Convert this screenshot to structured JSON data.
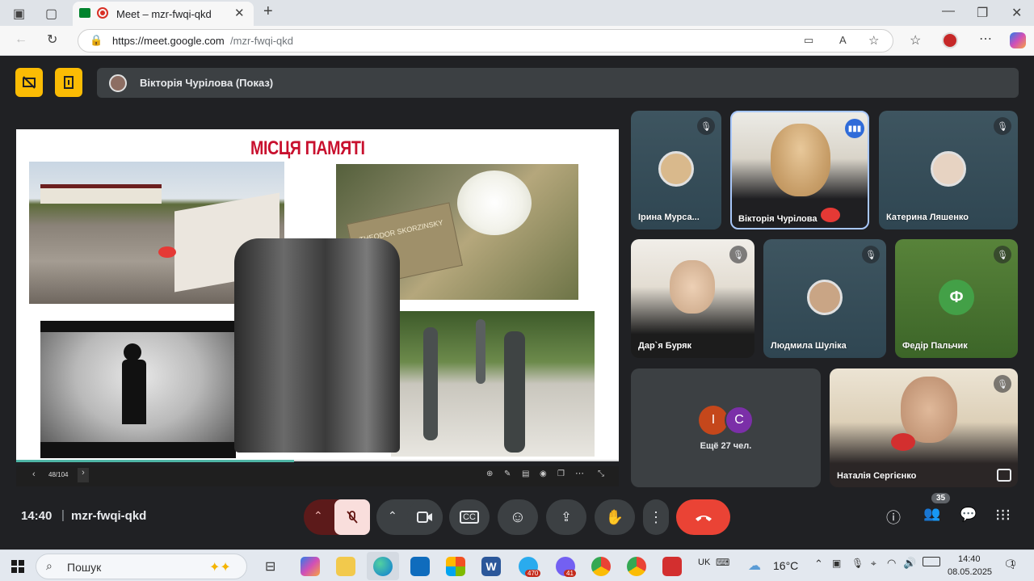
{
  "browser": {
    "tab_title": "Meet – mzr-fwqi-qkd",
    "url_host": "https://meet.google.com",
    "url_path": "/mzr-fwqi-qkd"
  },
  "meet": {
    "presenter_label": "Вікторія Чурілова (Показ)",
    "slide": {
      "title": "МІСЦЯ ПАМЯТІ",
      "plaque_text": "THEODOR SKORZINSKY",
      "page_indicator": "48/104"
    },
    "participants": [
      {
        "name": "Ірина Мурса...",
        "muted": true
      },
      {
        "name": "Вікторія Чурілова",
        "muted": false,
        "speaking": true
      },
      {
        "name": "Катерина Ляшенко",
        "muted": true
      },
      {
        "name": "Дар`я Буряк",
        "muted": true
      },
      {
        "name": "Людмила Шуліка",
        "muted": true
      },
      {
        "name": "Федір Пальчик",
        "muted": true,
        "initial": "Ф"
      },
      {
        "name": "Наталія Сергієнко",
        "muted": true
      }
    ],
    "more_tile": {
      "initials": [
        "І",
        "С"
      ],
      "label": "Ещё 27 чел."
    },
    "time": "14:40",
    "separator": "|",
    "meeting_code": "mzr-fwqi-qkd",
    "people_count": "35",
    "colors": {
      "accent_yellow": "#fbbc04",
      "leave_red": "#ea4335",
      "mic_off_bg": "#f9dedc",
      "slide_title_red": "#c8102e",
      "phi_green": "#43a047"
    }
  },
  "taskbar": {
    "search_label": "Пошук",
    "telegram_badge": "470",
    "viber_badge": "41",
    "lang": "UK",
    "weather": "16°C",
    "clock_time": "14:40",
    "clock_date": "08.05.2025",
    "notification_count": "1"
  }
}
